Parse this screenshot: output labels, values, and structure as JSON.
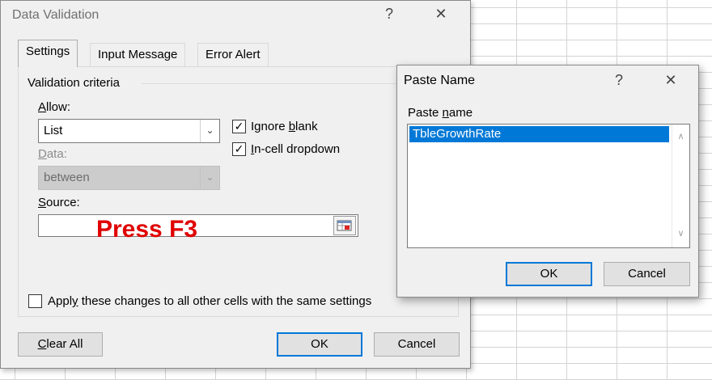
{
  "data_validation": {
    "title": "Data Validation",
    "help_icon": "?",
    "close_icon": "✕",
    "tabs": [
      {
        "label": "Settings",
        "active": true
      },
      {
        "label": "Input Message",
        "active": false
      },
      {
        "label": "Error Alert",
        "active": false
      }
    ],
    "group_label": "Validation criteria",
    "allow_label": "Allow:",
    "allow_value": "List",
    "data_label": "Data:",
    "data_value": "between",
    "source_label": "Source:",
    "source_value": "",
    "ignore_blank": {
      "label": "Ignore blank",
      "checked": true
    },
    "in_cell_dropdown": {
      "label": "In-cell dropdown",
      "checked": true
    },
    "apply_all": {
      "label": "Apply these changes to all other cells with the same settings",
      "checked": false
    },
    "annotation": "Press F3",
    "buttons": {
      "clear_all": "Clear All",
      "ok": "OK",
      "cancel": "Cancel"
    }
  },
  "paste_name": {
    "title": "Paste Name",
    "help_icon": "?",
    "close_icon": "✕",
    "list_label": "Paste name",
    "items": [
      "TbleGrowthRate"
    ],
    "selected_index": 0,
    "buttons": {
      "ok": "OK",
      "cancel": "Cancel"
    }
  },
  "colors": {
    "annotation": "#e00000",
    "selection": "#0078d7",
    "default_button_border": "#0078d7",
    "dialog_bg": "#f0f0f0"
  }
}
